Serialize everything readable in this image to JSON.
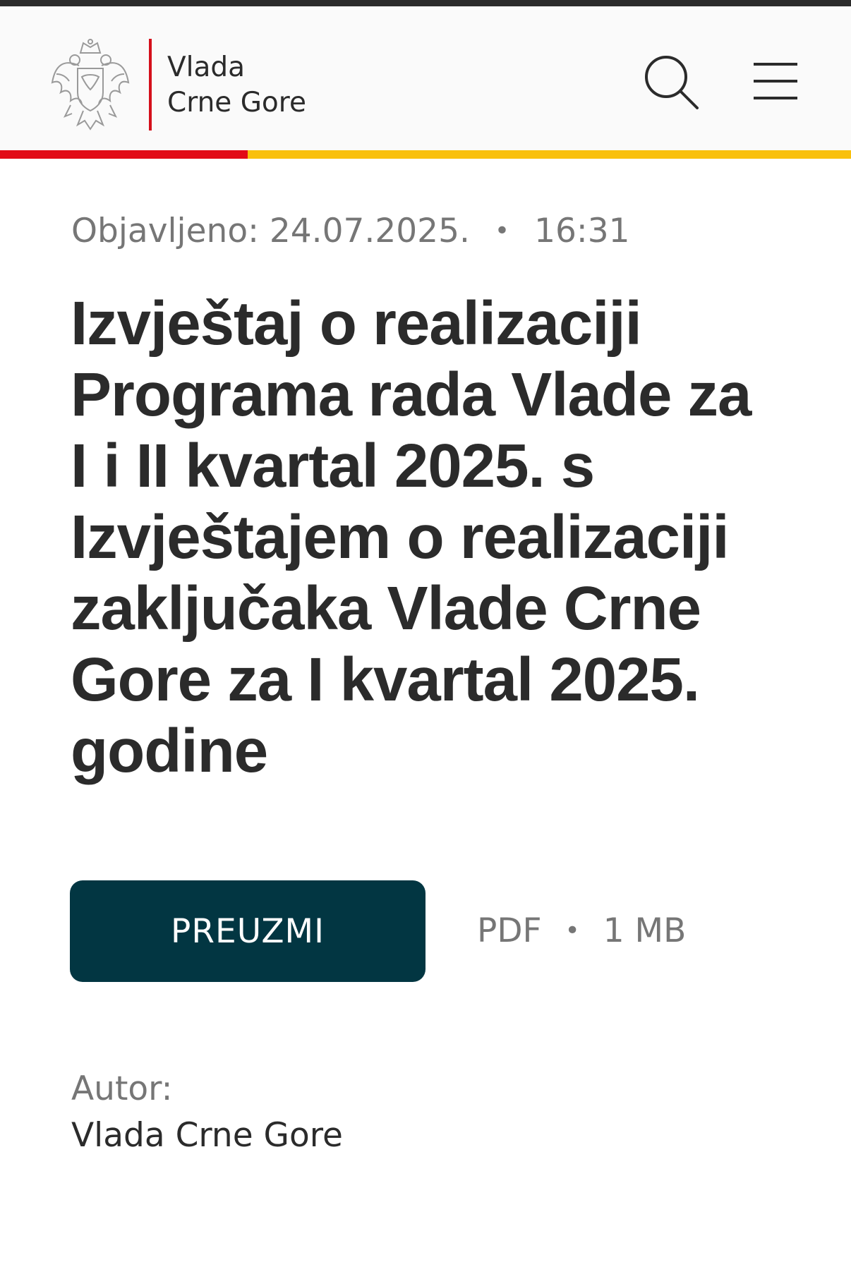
{
  "header": {
    "brand_line1": "Vlada",
    "brand_line2": "Crne Gore",
    "logo_icon": "coat-of-arms",
    "search_icon": "search-icon",
    "menu_icon": "hamburger-menu-icon",
    "colors": {
      "accent_red": "#e20b17",
      "accent_yellow": "#f9c00c",
      "topbar": "#2b2b2b"
    }
  },
  "article": {
    "published_label": "Objavljeno:",
    "published_date": "24.07.2025.",
    "dot": "•",
    "published_time": "16:31",
    "title": "Izvještaj o realizaciji Programa rada Vlade za I i II kvartal 2025. s Izvještajem o realizaciji zaključaka Vlade Crne Gore za I kvartal 2025. godine"
  },
  "download": {
    "button_label": "PREUZMI",
    "button_color": "#023642",
    "file_type": "PDF",
    "file_size": "1 MB"
  },
  "author": {
    "label": "Autor:",
    "name": "Vlada Crne Gore"
  }
}
